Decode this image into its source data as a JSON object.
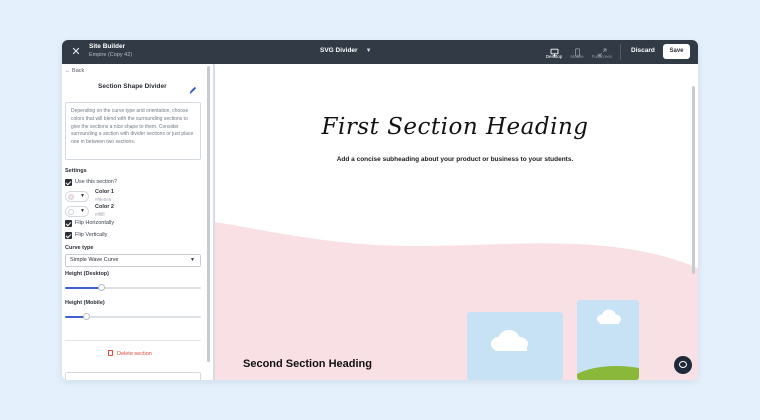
{
  "topbar": {
    "title": "Site Builder",
    "subtitle": "Empire (Copy 42)",
    "page_selector": "SVG Divider",
    "devices": [
      {
        "label": "Desktop",
        "icon": "desktop-icon",
        "active": true
      },
      {
        "label": "Mobile",
        "icon": "mobile-icon",
        "active": false
      },
      {
        "label": "Fullscreen",
        "icon": "fullscreen-icon",
        "active": false
      }
    ],
    "discard_label": "Discard",
    "save_label": "Save"
  },
  "panel": {
    "back_label": "Back",
    "title": "Section Shape Divider",
    "description": "Depending on the curve type and orientation, choose colors that will blend with the surrounding sections to give the sections a nice shape to them. Consider surrounding a section with divider sections or just place one in between two sections.",
    "settings_label": "Settings",
    "use_section_label": "Use this section?",
    "colors": [
      {
        "name": "Color 1",
        "hex": "#f9e0e5",
        "swatch": "#f9e0e5"
      },
      {
        "name": "Color 2",
        "hex": "#ffffff",
        "swatch": "#ffffff"
      }
    ],
    "flip_horizontally_label": "Flip Horizontally",
    "flip_vertically_label": "Flip Vertically",
    "curve_type_label": "Curve type",
    "curve_type_value": "Simple Wave Curve",
    "height_desktop_label": "Height (Desktop)",
    "height_desktop_fraction": 0.27,
    "height_mobile_label": "Height (Mobile)",
    "height_mobile_fraction": 0.16,
    "delete_label": "Delete section"
  },
  "canvas": {
    "heading": "First Section Heading",
    "subheading": "Add a concise subheading about your product or business to your students.",
    "second_heading": "Second Section Heading",
    "wave_color": "#f9e0e5",
    "accent": "#3f5fd6"
  }
}
